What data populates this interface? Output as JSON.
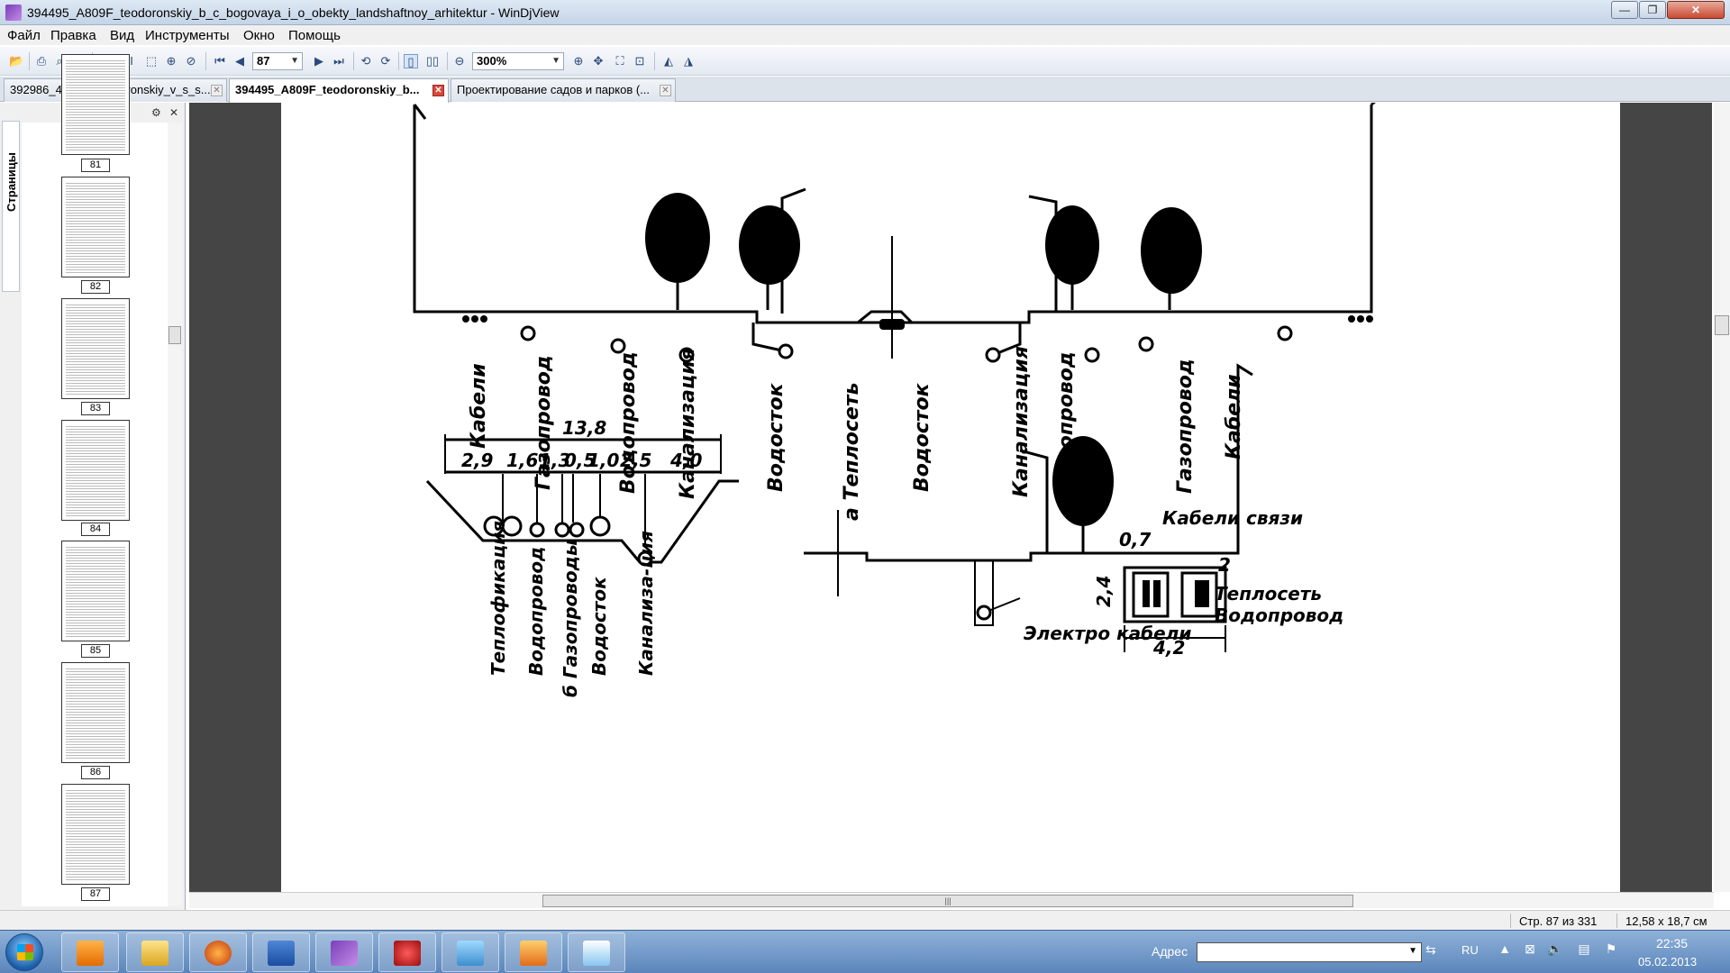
{
  "window": {
    "title": "394495_A809F_teodoronskiy_b_c_bogovaya_i_o_obekty_landshaftnoy_arhitektur - WinDjView",
    "min": "—",
    "max": "❐",
    "close": "✕"
  },
  "menu": [
    "Файл",
    "Правка",
    "Вид",
    "Инструменты",
    "Окно",
    "Помощь"
  ],
  "toolbar": {
    "page_number": "87",
    "zoom": "300%"
  },
  "tabs": [
    {
      "label": "392986_4B98A_teodoronskiy_v_s_s..."
    },
    {
      "label": "394495_A809F_teodoronskiy_b..."
    },
    {
      "label": "Проектирование садов и парков (..."
    }
  ],
  "sidebar": {
    "tab_label": "Страницы",
    "thumbnails": [
      "81",
      "82",
      "83",
      "84",
      "85",
      "86",
      "87"
    ]
  },
  "drawing": {
    "top_labels": [
      "Кабели",
      "Газопровод",
      "Водопровод",
      "Канализация",
      "Водосток",
      "а Теплосеть",
      "Водосток",
      "Канализация",
      "Водопровод",
      "Газопровод",
      "Кабели"
    ],
    "trench": {
      "total": "13,8",
      "dims": [
        "2,9",
        "1,6",
        "1,3",
        "0,5",
        "1,0",
        "2,5",
        "4,0"
      ],
      "labels": [
        "Теплофикация",
        "Водопровод",
        "б Газопроводы",
        "Водосток",
        "Канализа-ция"
      ]
    },
    "tunnel": {
      "dim_07": "0,7",
      "dim_2": "2",
      "dim_24": "2,4",
      "dim_42": "4,2",
      "label_comm": "Кабели связи",
      "label_heat": "Теплосеть",
      "label_water": "Водопровод",
      "label_elec": "Электро кабели"
    }
  },
  "status": {
    "page": "Стр. 87 из 331",
    "size": "12,58 x 18,7 см"
  },
  "taskbar": {
    "address_label": "Адрес",
    "lang": "RU",
    "time": "22:35",
    "date": "05.02.2013"
  }
}
